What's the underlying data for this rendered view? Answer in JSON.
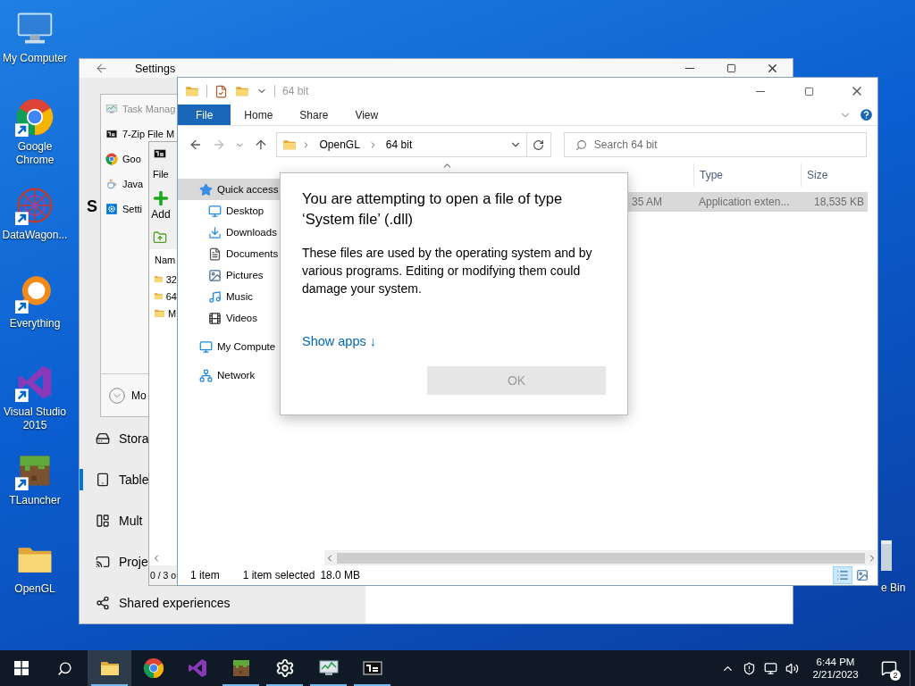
{
  "desktop_icons": [
    {
      "label": "My Computer",
      "kind": "computer",
      "shortcut": false
    },
    {
      "label": "Google Chrome",
      "kind": "chrome",
      "shortcut": true
    },
    {
      "label": "DataWagon...",
      "kind": "network",
      "shortcut": true
    },
    {
      "label": "Everything",
      "kind": "search",
      "shortcut": true
    },
    {
      "label": "Visual Studio 2015",
      "kind": "studio",
      "shortcut": true
    },
    {
      "label": "TLauncher",
      "kind": "block",
      "shortcut": true
    },
    {
      "label": "OpenGL",
      "kind": "folder",
      "shortcut": false
    }
  ],
  "recycle_bin": {
    "label": "e Bin"
  },
  "settings_window": {
    "title": "Settings",
    "heading": "S",
    "nav_items": [
      {
        "label": "Stora",
        "kind": "storage",
        "selected": false
      },
      {
        "label": "Table",
        "kind": "tablet",
        "selected": true
      },
      {
        "label": "Mult",
        "kind": "multitask",
        "selected": false
      },
      {
        "label": "Proje",
        "kind": "project",
        "selected": false
      },
      {
        "label": "Shared experiences",
        "kind": "shared",
        "selected": false
      }
    ]
  },
  "jump_list": {
    "items": [
      {
        "label": "Task Manag",
        "kind": "taskmgr",
        "disabled": true
      },
      {
        "label": "7-Zip File M",
        "kind": "zip",
        "disabled": false
      },
      {
        "label": "Goo",
        "kind": "chrome",
        "disabled": false
      },
      {
        "label": "Java",
        "kind": "java",
        "disabled": false
      },
      {
        "label": "Setti",
        "kind": "gear",
        "disabled": false
      }
    ],
    "more": "Mo"
  },
  "archive_window": {
    "menu": "File",
    "toolbar_button": "Add",
    "column": "Nam",
    "rows": [
      {
        "name": "32"
      },
      {
        "name": "64"
      },
      {
        "name": "M"
      }
    ],
    "status": "0 / 3 o"
  },
  "explorer": {
    "title": "64 bit",
    "ribbon_tabs": [
      {
        "label": "File",
        "kind": "menu"
      },
      {
        "label": "Home",
        "kind": "tab"
      },
      {
        "label": "Share",
        "kind": "tab"
      },
      {
        "label": "View",
        "kind": "tab"
      }
    ],
    "breadcrumb": [
      "OpenGL",
      "64 bit"
    ],
    "search": {
      "placeholder": "Search 64 bit"
    },
    "nav": [
      {
        "label": "Quick access",
        "kind": "star",
        "selected": true,
        "children": [
          {
            "label": "Desktop",
            "kind": "desktop",
            "selected": false
          },
          {
            "label": "Downloads",
            "kind": "download",
            "selected": false
          },
          {
            "label": "Documents",
            "kind": "documents",
            "selected": false
          },
          {
            "label": "Pictures",
            "kind": "pictures",
            "selected": false
          },
          {
            "label": "Music",
            "kind": "music",
            "selected": false
          },
          {
            "label": "Videos",
            "kind": "videos",
            "selected": false
          }
        ]
      },
      {
        "label": "My Compute",
        "kind": "computer",
        "selected": false
      },
      {
        "label": "Network",
        "kind": "network",
        "selected": false
      }
    ],
    "columns": [
      "Type",
      "Size"
    ],
    "rows": [
      {
        "date": "35 AM",
        "type": "Application exten...",
        "size": "18,535 KB",
        "selected": true
      }
    ],
    "status": {
      "count": "1 item",
      "selection": "1 item selected",
      "size": "18.0 MB"
    },
    "views": [
      {
        "kind": "details",
        "selected": true
      },
      {
        "kind": "tiles",
        "selected": false
      }
    ]
  },
  "dialog": {
    "title": "You are attempting to open a file of type ‘System file’ (.dll)",
    "body": "These files are used by the operating system and by various programs. Editing or modifying them could damage your system.",
    "link": "Show apps ↓",
    "button": {
      "label": "OK",
      "disabled": true
    }
  },
  "taskbar": {
    "apps": [
      {
        "kind": "explorer",
        "running": true,
        "active": true
      },
      {
        "kind": "chrome",
        "running": false,
        "active": false
      },
      {
        "kind": "studio",
        "running": false,
        "active": false
      },
      {
        "kind": "block",
        "running": true,
        "active": false
      },
      {
        "kind": "gear",
        "running": true,
        "active": false
      },
      {
        "kind": "taskmgr",
        "running": true,
        "active": false
      },
      {
        "kind": "zip",
        "running": true,
        "active": false
      }
    ],
    "time": "6:44 PM",
    "date": "2/21/2023",
    "notification_count": "2"
  }
}
